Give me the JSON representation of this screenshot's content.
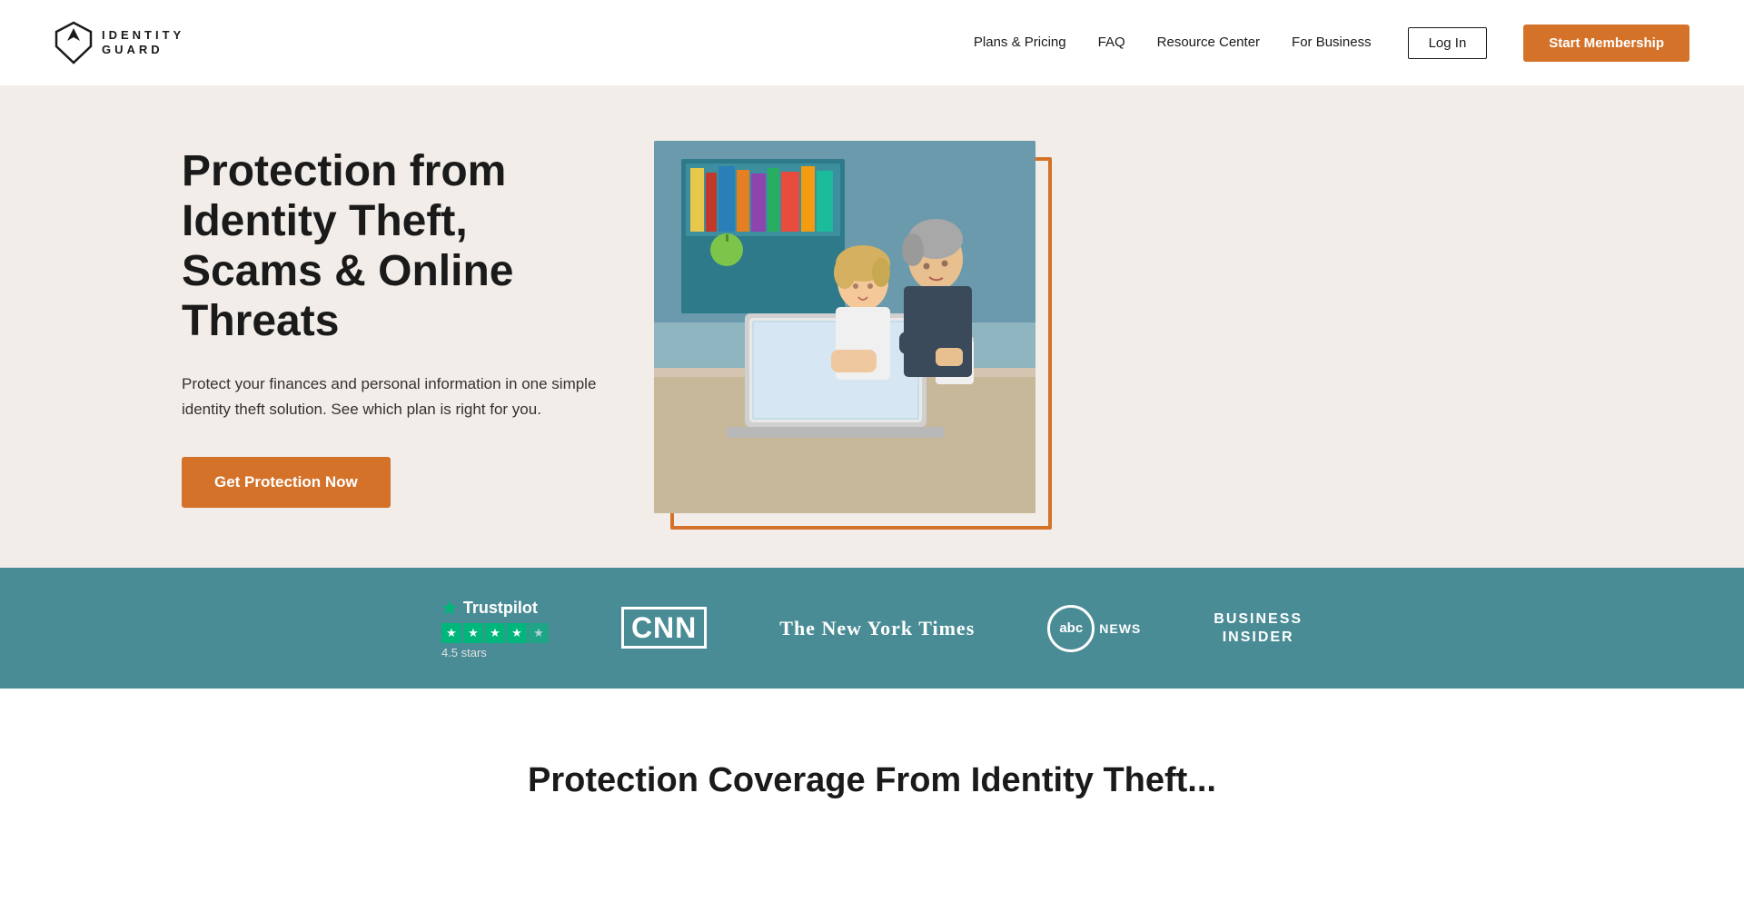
{
  "header": {
    "logo_text_line1": "IDENTITY",
    "logo_text_line2": "GUARD",
    "nav": {
      "items": [
        {
          "label": "Plans & Pricing",
          "id": "plans-pricing"
        },
        {
          "label": "FAQ",
          "id": "faq"
        },
        {
          "label": "Resource Center",
          "id": "resource-center"
        },
        {
          "label": "For Business",
          "id": "for-business"
        }
      ]
    },
    "login_label": "Log In",
    "start_label": "Start Membership"
  },
  "hero": {
    "title": "Protection from Identity Theft, Scams & Online Threats",
    "subtitle": "Protect your finances and personal information in one simple identity theft solution. See which plan is right for you.",
    "cta_label": "Get Protection Now",
    "image_alt": "Couple looking at laptop"
  },
  "press_bar": {
    "trustpilot": {
      "name": "Trustpilot",
      "stars": 4.5,
      "rating_text": "4.5 stars"
    },
    "logos": [
      {
        "id": "cnn",
        "label": "CNN"
      },
      {
        "id": "nyt",
        "label": "The New York Times"
      },
      {
        "id": "abc",
        "label": "abc NEWS"
      },
      {
        "id": "bi",
        "label": "BUSINESS\nINSIDER"
      }
    ]
  },
  "bottom": {
    "title": "Protection Coverage From Identity Theft..."
  },
  "colors": {
    "cta_orange": "#d4722a",
    "teal": "#4a8c96",
    "dark": "#1a1a1a",
    "hero_bg": "#f2ede8"
  }
}
